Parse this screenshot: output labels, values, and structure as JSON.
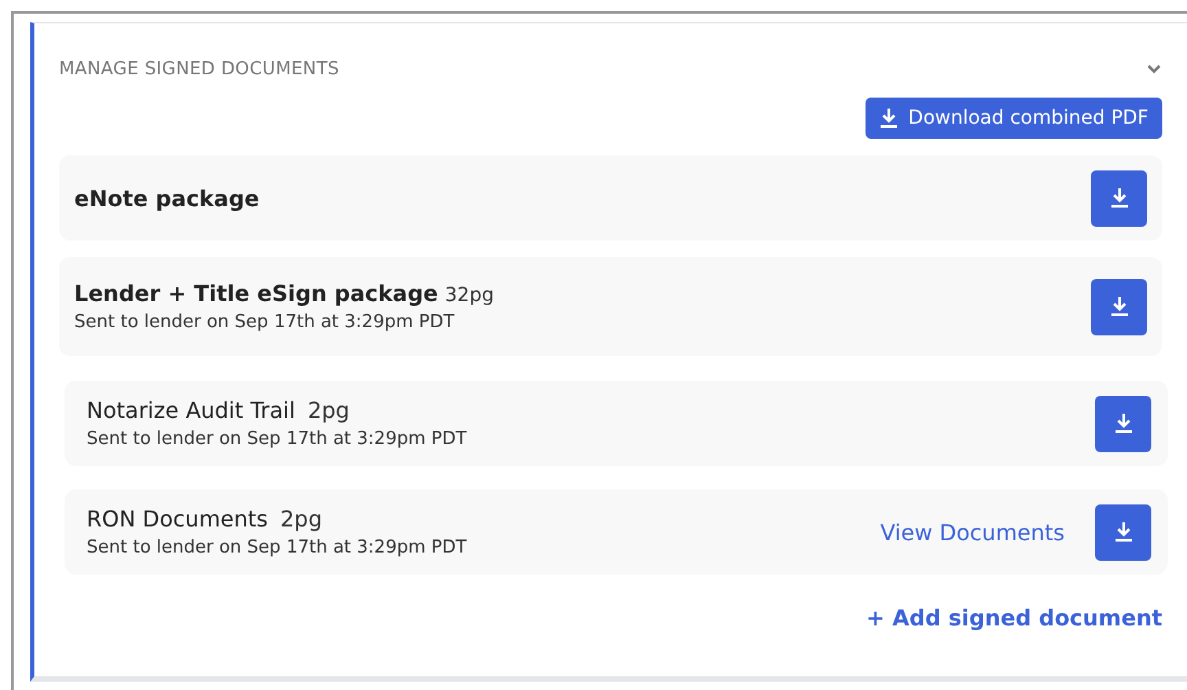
{
  "section": {
    "title": "MANAGE SIGNED DOCUMENTS",
    "combined_button": "Download combined PDF",
    "add_link": "+ Add signed document"
  },
  "documents": [
    {
      "name": "eNote package"
    },
    {
      "name": "Lender + Title eSign package",
      "pages": "32pg",
      "sent": "Sent to lender on Sep 17th at 3:29pm PDT"
    },
    {
      "name": "Notarize Audit Trail",
      "pages": "2pg",
      "sent": "Sent to lender on Sep 17th at 3:29pm PDT"
    },
    {
      "name": "RON Documents",
      "pages": "2pg",
      "sent": "Sent to lender on Sep 17th at 3:29pm PDT",
      "view_link": "View Documents"
    }
  ]
}
